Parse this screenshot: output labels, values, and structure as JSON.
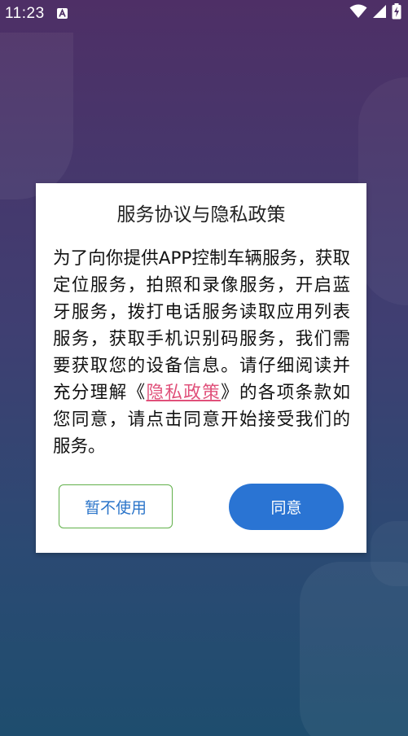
{
  "status_bar": {
    "time": "11:23",
    "notification_icon": "a-badge-icon",
    "wifi_icon": "wifi-icon",
    "signal_icon": "cell-signal-icon",
    "battery_icon": "battery-charging-icon"
  },
  "dialog": {
    "title": "服务协议与隐私政策",
    "body_before_link": "为了向你提供APP控制车辆服务，获取定位服务，拍照和录像服务，开启蓝牙服务，拨打电话服务读取应用列表服务，获取手机识别码服务，我们需要获取您的设备信息。请仔细阅读并充分理解《",
    "policy_link": "隐私政策",
    "body_after_link": "》的各项条款如您同意，请点击同意开始接受我们的服务。",
    "decline_label": "暂不使用",
    "agree_label": "同意"
  },
  "colors": {
    "link": "#e0507a",
    "agree_button": "#2a74d3",
    "decline_border": "#61b04a",
    "decline_text": "#2a74c9"
  }
}
